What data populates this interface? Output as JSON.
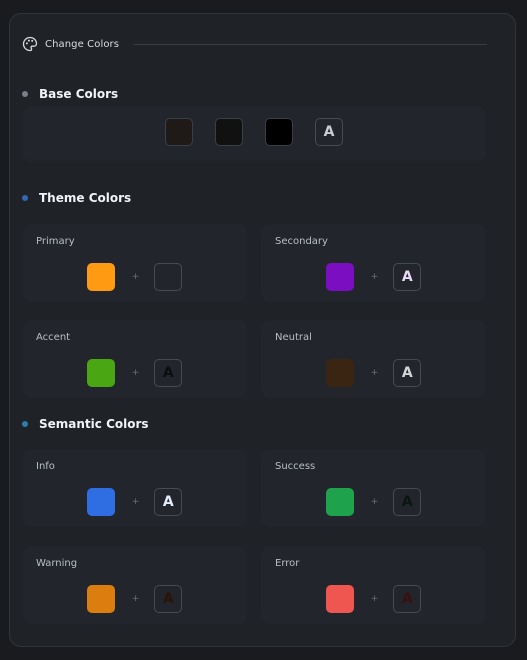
{
  "header": {
    "title": "Change Colors",
    "icon": "palette-icon"
  },
  "sections": {
    "base": {
      "title": "Base Colors",
      "dot_color": "#7b8088"
    },
    "theme": {
      "title": "Theme Colors",
      "dot_color": "#3467b4"
    },
    "semantic": {
      "title": "Semantic Colors",
      "dot_color": "#2b7fa9"
    }
  },
  "base_colors": {
    "swatches": [
      {
        "name": "base-100",
        "color": "#1f1a18"
      },
      {
        "name": "base-200",
        "color": "#121111"
      },
      {
        "name": "base-300",
        "color": "#000000"
      }
    ],
    "content": {
      "glyph": "A",
      "color": "#c9ccd2"
    }
  },
  "theme_colors": [
    {
      "label": "Primary",
      "swatch": "#ff9a12",
      "content": {
        "glyph": "A",
        "color": "#22252a"
      }
    },
    {
      "label": "Secondary",
      "swatch": "#7b0ec0",
      "content": {
        "glyph": "A",
        "color": "#e9d9f7"
      }
    },
    {
      "label": "Accent",
      "swatch": "#4aa612",
      "content": {
        "glyph": "A",
        "color": "#0b0d0e"
      }
    },
    {
      "label": "Neutral",
      "swatch": "#3a2412",
      "content": {
        "glyph": "A",
        "color": "#d2d4d8"
      }
    }
  ],
  "semantic_colors": [
    {
      "label": "Info",
      "swatch": "#2f6ee2",
      "content": {
        "glyph": "A",
        "color": "#e3ebfb"
      }
    },
    {
      "label": "Success",
      "swatch": "#1ea24b",
      "content": {
        "glyph": "A",
        "color": "#0b1510"
      }
    },
    {
      "label": "Warning",
      "swatch": "#dc7d10",
      "content": {
        "glyph": "A",
        "color": "#2a1405"
      }
    },
    {
      "label": "Error",
      "swatch": "#ef5650",
      "content": {
        "glyph": "A",
        "color": "#3a0f0d"
      }
    }
  ],
  "plus_glyph": "+"
}
